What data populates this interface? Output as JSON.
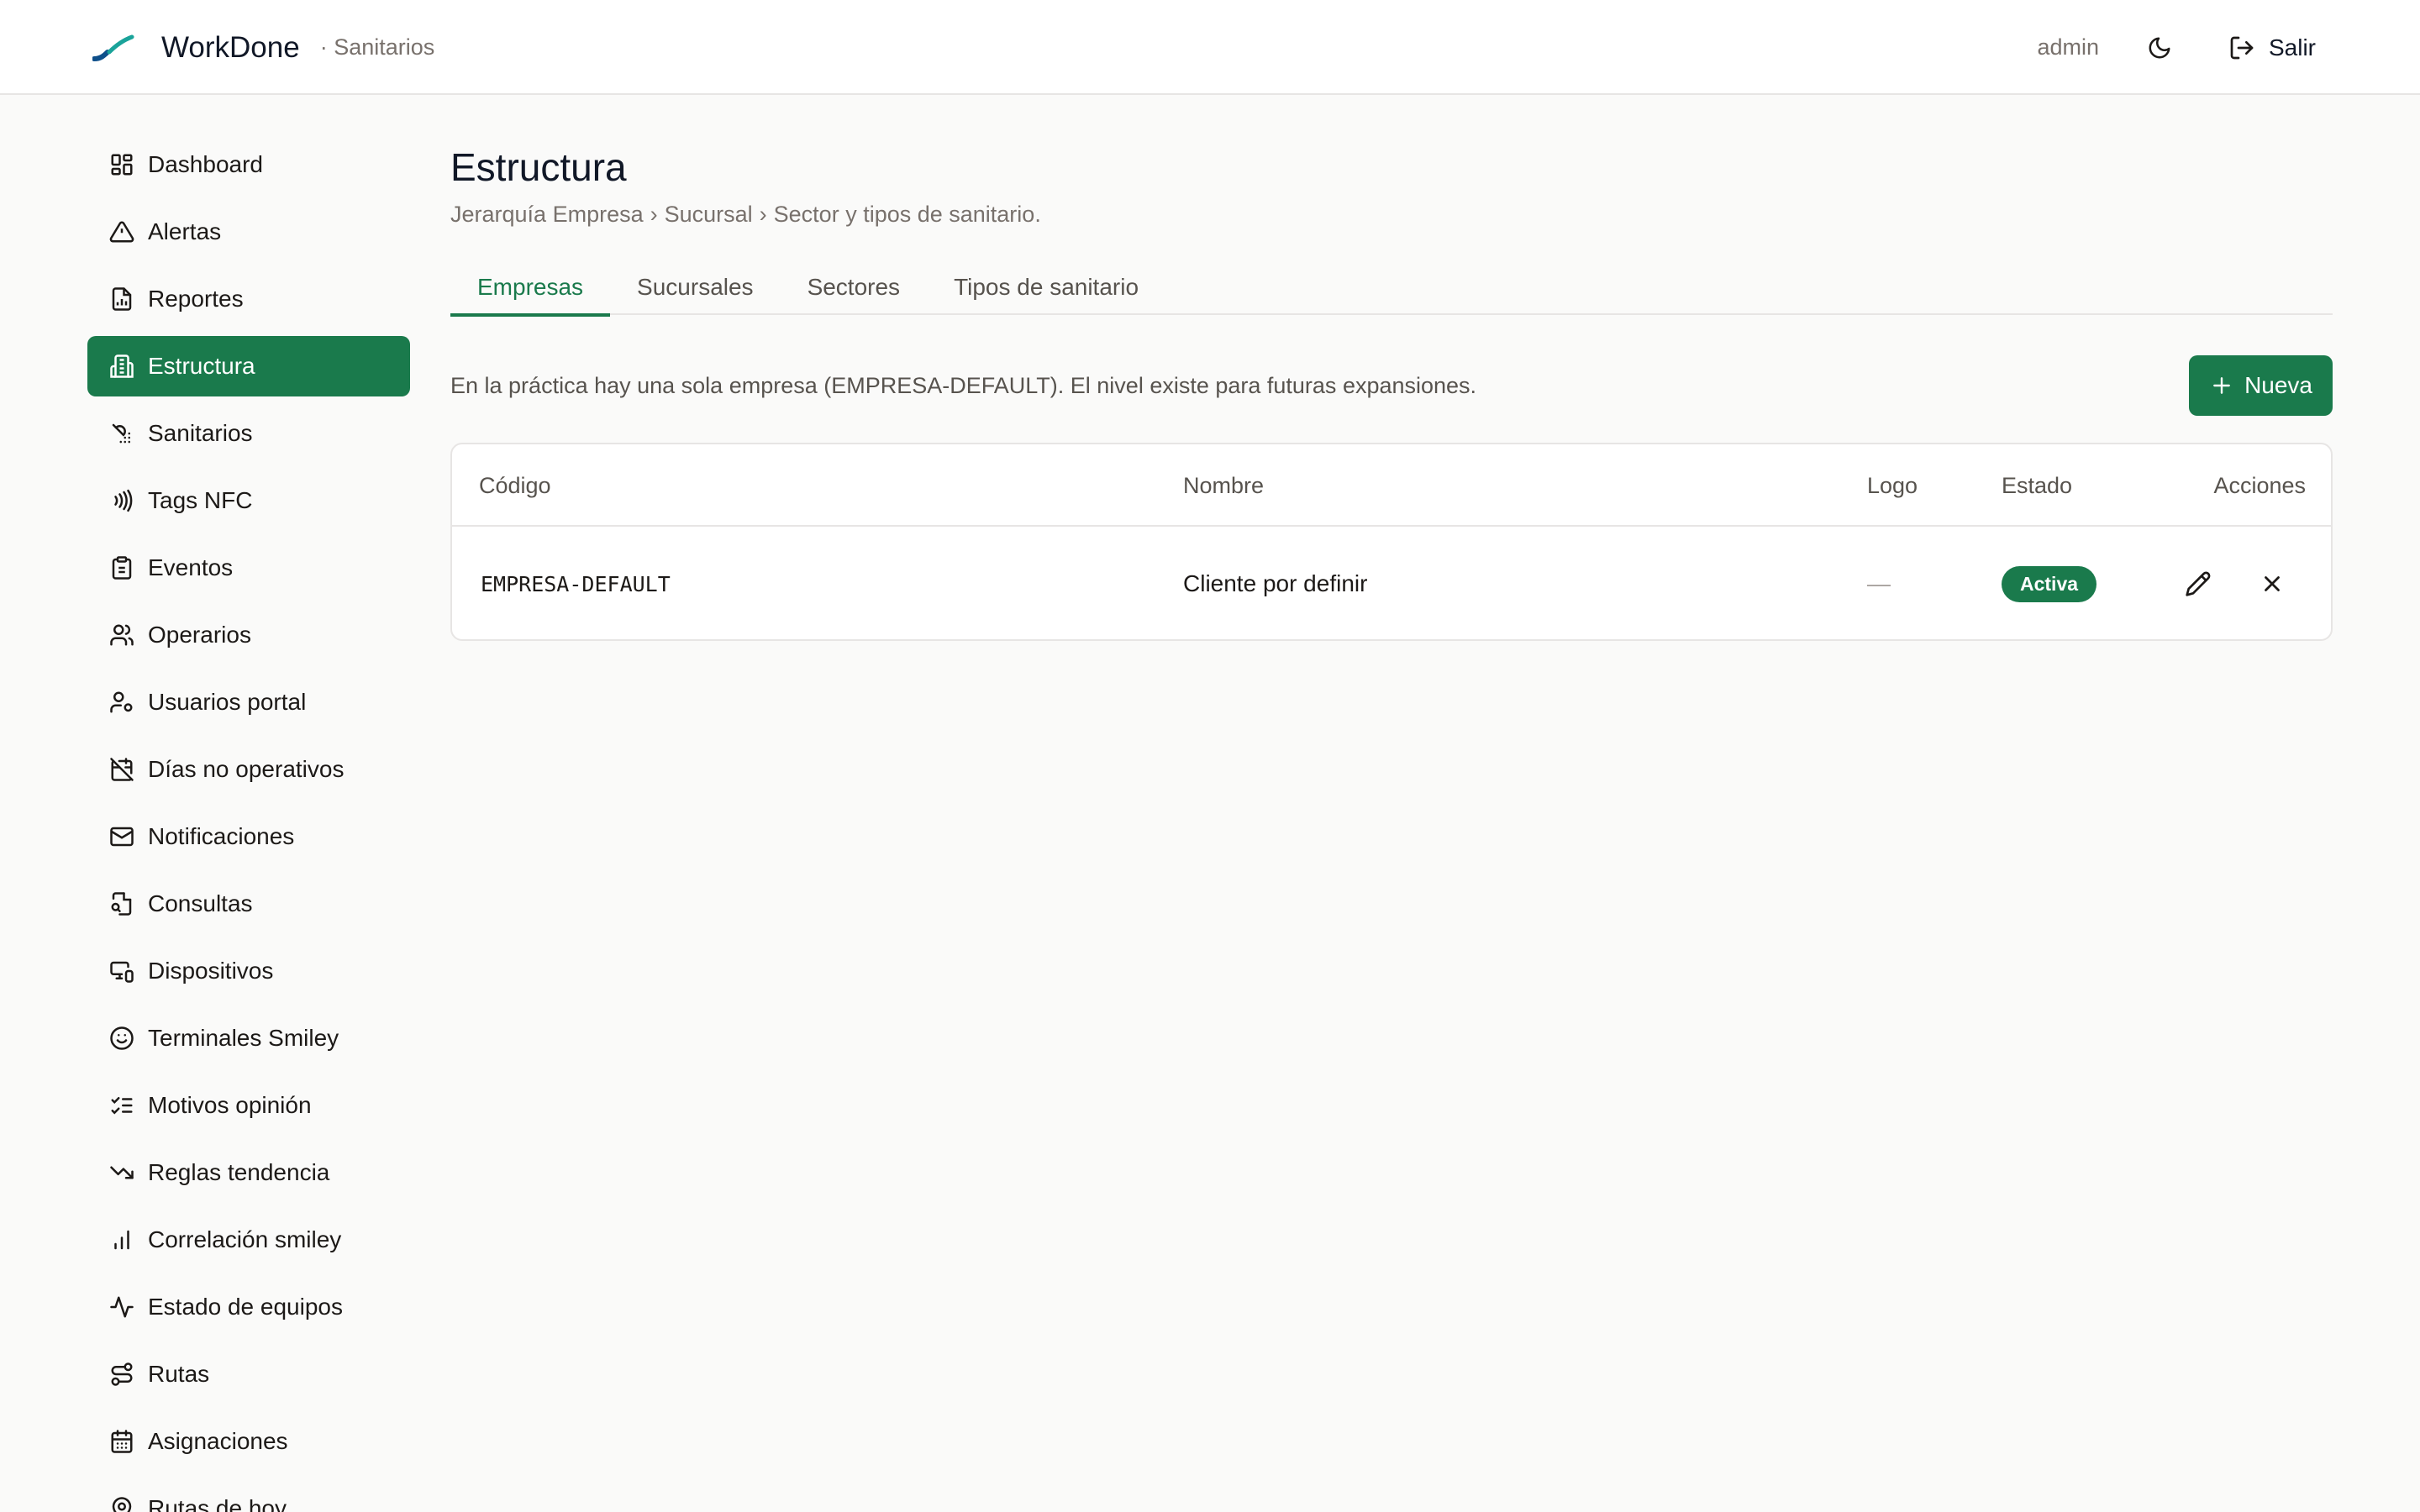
{
  "header": {
    "app_name": "WorkDone",
    "app_section": "· Sanitarios",
    "user": "admin",
    "logout_label": "Salir"
  },
  "sidebar": {
    "items": [
      {
        "label": "Dashboard",
        "icon": "layout-dashboard-icon",
        "active": false
      },
      {
        "label": "Alertas",
        "icon": "alert-triangle-icon",
        "active": false
      },
      {
        "label": "Reportes",
        "icon": "report-file-icon",
        "active": false
      },
      {
        "label": "Estructura",
        "icon": "building-icon",
        "active": true
      },
      {
        "label": "Sanitarios",
        "icon": "shower-icon",
        "active": false
      },
      {
        "label": "Tags NFC",
        "icon": "nfc-icon",
        "active": false
      },
      {
        "label": "Eventos",
        "icon": "clipboard-icon",
        "active": false
      },
      {
        "label": "Operarios",
        "icon": "users-icon",
        "active": false
      },
      {
        "label": "Usuarios portal",
        "icon": "user-cog-icon",
        "active": false
      },
      {
        "label": "Días no operativos",
        "icon": "calendar-off-icon",
        "active": false
      },
      {
        "label": "Notificaciones",
        "icon": "mail-icon",
        "active": false
      },
      {
        "label": "Consultas",
        "icon": "file-search-icon",
        "active": false
      },
      {
        "label": "Dispositivos",
        "icon": "devices-icon",
        "active": false
      },
      {
        "label": "Terminales Smiley",
        "icon": "smile-icon",
        "active": false
      },
      {
        "label": "Motivos opinión",
        "icon": "list-checks-icon",
        "active": false
      },
      {
        "label": "Reglas tendencia",
        "icon": "trending-down-icon",
        "active": false
      },
      {
        "label": "Correlación smiley",
        "icon": "bar-chart-icon",
        "active": false
      },
      {
        "label": "Estado de equipos",
        "icon": "activity-icon",
        "active": false
      },
      {
        "label": "Rutas",
        "icon": "route-icon",
        "active": false
      },
      {
        "label": "Asignaciones",
        "icon": "calendar-icon",
        "active": false
      },
      {
        "label": "Rutas de hoy",
        "icon": "map-pin-icon",
        "active": false
      }
    ]
  },
  "main": {
    "title": "Estructura",
    "breadcrumb": [
      "Jerarquía Empresa",
      "›",
      "Sucursal",
      "›",
      "Sector y tipos de sanitario."
    ],
    "tabs": [
      {
        "label": "Empresas",
        "active": true
      },
      {
        "label": "Sucursales",
        "active": false
      },
      {
        "label": "Sectores",
        "active": false
      },
      {
        "label": "Tipos de sanitario",
        "active": false
      }
    ],
    "intro": "En la práctica hay una sola empresa (EMPRESA-DEFAULT). El nivel existe para futuras expansiones.",
    "new_button": "Nueva",
    "table": {
      "columns": [
        "Código",
        "Nombre",
        "Logo",
        "Estado",
        "Acciones"
      ],
      "rows": [
        {
          "codigo": "EMPRESA-DEFAULT",
          "nombre": "Cliente por definir",
          "logo": "—",
          "estado": "Activa"
        }
      ]
    }
  },
  "colors": {
    "accent": "#1a7a4c",
    "background": "#fafaf9",
    "muted_text": "#78716c"
  }
}
